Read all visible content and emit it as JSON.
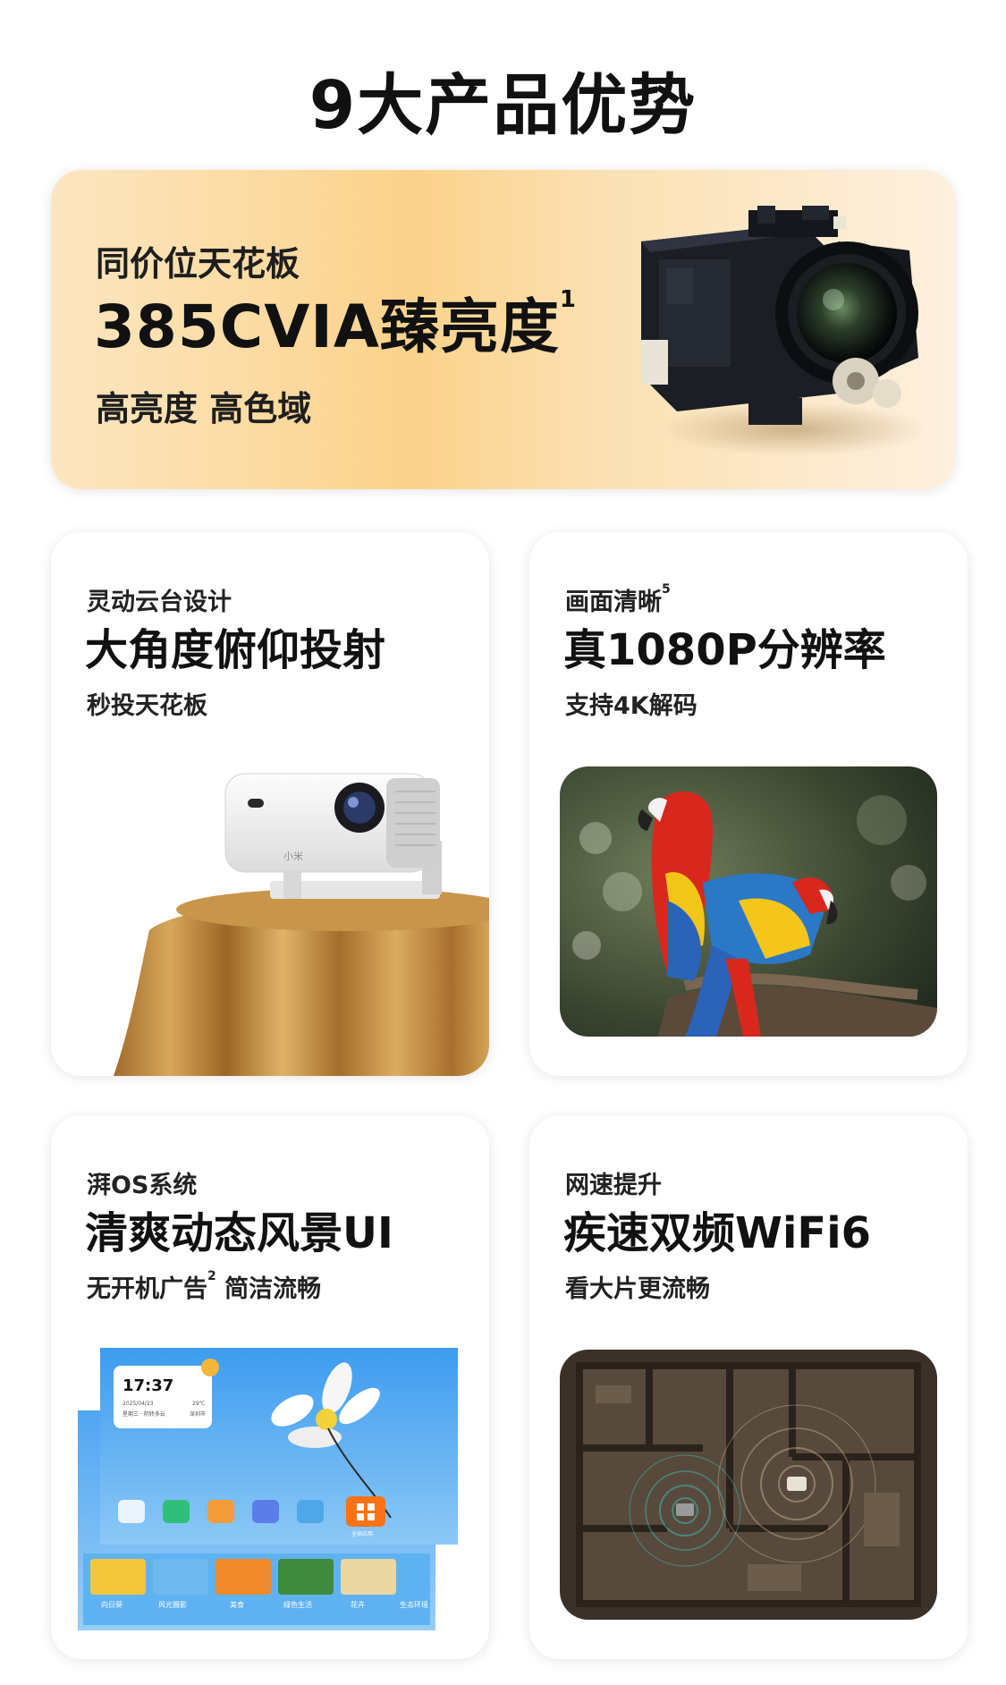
{
  "page": {
    "title": "9大产品优势"
  },
  "hero": {
    "kicker": "同价位天花板",
    "headline": "385CVIA臻亮度",
    "headline_sup": "1",
    "sub": "高亮度 高色域",
    "image": "optical-engine"
  },
  "cards": [
    {
      "kicker": "灵动云台设计",
      "headline": "大角度俯仰投射",
      "note": "秒投天花板",
      "image": "projector-on-table",
      "logo_text": "小米"
    },
    {
      "kicker": "画面清晰",
      "kicker_sup": "5",
      "headline": "真1080P分辨率",
      "note": "支持4K解码",
      "image": "parrots-photo"
    },
    {
      "kicker": "湃OS系统",
      "headline": "清爽动态风景UI",
      "note_a": "无开机广告",
      "note_sup": "2",
      "note_b": " 简洁流畅",
      "image": "os-home-screen",
      "screen": {
        "time": "17:37",
        "date": "2025/04/23",
        "temp": "29℃",
        "weather_line": "星期三 · 阴转多云",
        "location": "深圳市",
        "dock_more": "全部应用",
        "row_labels": [
          "向日葵",
          "风光摄影",
          "美食",
          "绿色生活",
          "花卉",
          "生态环境"
        ]
      }
    },
    {
      "kicker": "网速提升",
      "headline": "疾速双频WiFi6",
      "note": "看大片更流畅",
      "image": "wifi-floorplan"
    }
  ],
  "colors": {
    "hero_gradient_mid": "#fbd28b",
    "dock_orange": "#f97316",
    "screen_blue": "#4aa3ef"
  }
}
